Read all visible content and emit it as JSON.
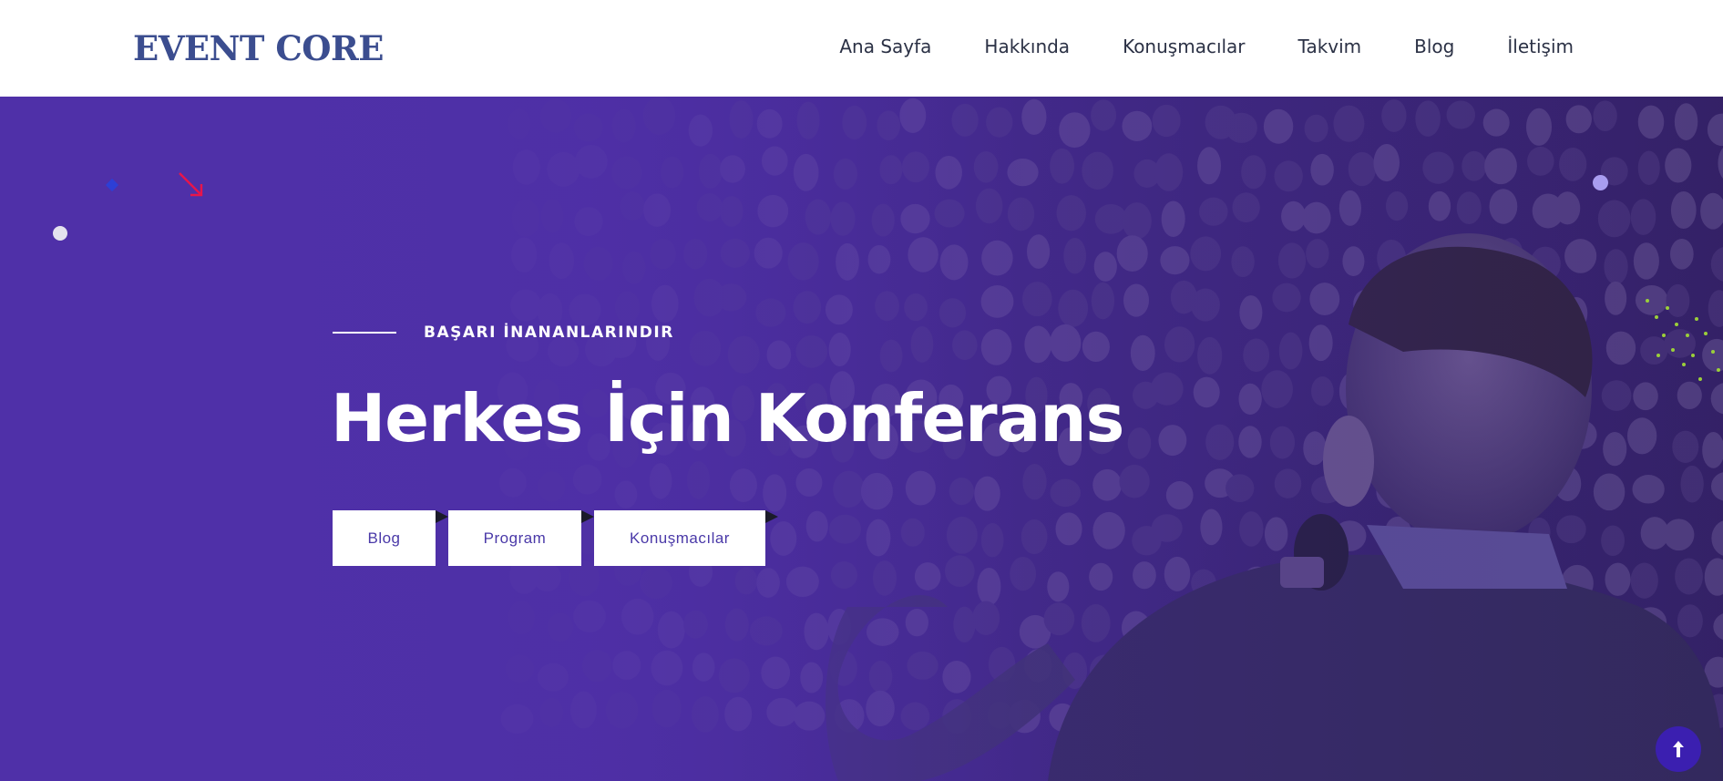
{
  "header": {
    "logo": "EVENT CORE",
    "nav": [
      "Ana Sayfa",
      "Hakkında",
      "Konuşmacılar",
      "Takvim",
      "Blog",
      "İletişim"
    ]
  },
  "hero": {
    "tagline": "BAŞARI İNANANLARINDIR",
    "title": "Herkes İçin Konferans",
    "buttons": [
      "Blog",
      "Program",
      "Konuşmacılar"
    ],
    "background_image": "conference-speaker-crowd",
    "overlay_color": "#4f30a8"
  },
  "icons": {
    "scroll_top": "arrow-up-icon",
    "decor": [
      "white-dot",
      "blue-diamond",
      "red-arrow-icon",
      "lilac-dot",
      "green-dot-cluster"
    ]
  },
  "colors": {
    "logo": "#3b4d8f",
    "nav_text": "#2b3145",
    "button_text": "#4a39a8",
    "scroll_top_bg": "#3b1fb0"
  }
}
